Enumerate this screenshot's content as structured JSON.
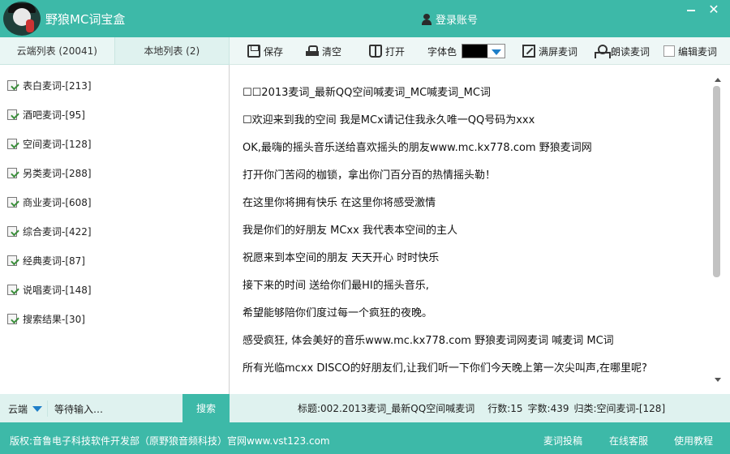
{
  "window": {
    "title": "野狼MC词宝盒",
    "login_label": "登录账号",
    "minimize_glyph": "—",
    "close_glyph": "✕"
  },
  "left_tabs": {
    "cloud": "云端列表 (20041)",
    "local": "本地列表 (2)"
  },
  "categories": [
    "表白麦词-[213]",
    "酒吧麦词-[95]",
    "空间麦词-[128]",
    "另类麦词-[288]",
    "商业麦词-[608]",
    "综合麦词-[422]",
    "经典麦词-[87]",
    "说唱麦词-[148]",
    "搜索结果-[30]"
  ],
  "toolbar": {
    "save": "保存",
    "clear": "清空",
    "open": "打开",
    "font_color_label": "字体色",
    "font_color_value": "#000000",
    "fullscreen": "满屏麦词",
    "read_aloud": "朗读麦词",
    "edit_label": "编辑麦词"
  },
  "editor": {
    "lines": [
      "☐☐2013麦词_最新QQ空间喊麦词_MC喊麦词_MC词",
      "☐欢迎来到我的空间 我是MCx请记住我永久唯一QQ号码为xxx",
      "OK,最嗨的摇头音乐送给喜欢摇头的朋友www.mc.kx778.com 野狼麦词网",
      "打开你门苦闷的枷锁，拿出你门百分百的热情摇头勒！",
      "在这里你将拥有快乐 在这里你将感受激情",
      "我是你们的好朋友 MCxx 我代表本空间的主人",
      "祝愿来到本空间的朋友 天天开心 时时快乐",
      "接下来的时间 送给你们最HI的摇头音乐,",
      "希望能够陪你们度过每一个疯狂的夜晚。",
      "感受疯狂, 体会美好的音乐www.mc.kx778.com 野狼麦词网麦词 喊麦词 MC词",
      "所有光临mcxx DISCO的好朋友们,让我们听一下你们今天晚上第一次尖叫声,在哪里呢?"
    ]
  },
  "search": {
    "scope": "云端",
    "input_value": "等待输入…",
    "button": "搜索"
  },
  "status": {
    "title": "标题:002.2013麦词_最新QQ空间喊麦词",
    "line_count": "行数:15",
    "char_count": "字数:439",
    "category": "归类:空间麦词-[128]"
  },
  "footer": {
    "copyright": "版权:音鲁电子科技软件开发部（原野狼音频科技）官网www.vst123.com",
    "submit": "麦词投稿",
    "support": "在线客服",
    "tutorial": "使用教程"
  }
}
